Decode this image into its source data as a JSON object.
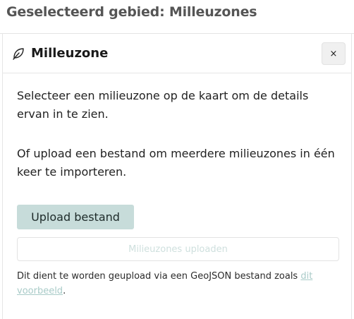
{
  "page": {
    "title": "Geselecteerd gebied: Milleuzones"
  },
  "panel": {
    "icon": "leaf-icon",
    "title": "Milleuzone",
    "close_label": "×",
    "paragraph_1": "Selecteer een milieuzone op de kaart om de details ervan in te zien.",
    "paragraph_2": "Of upload een bestand om meerdere milieuzones in één keer te importeren.",
    "upload_button_label": "Upload bestand",
    "submit_button_label": "Milieuzones uploaden",
    "hint_prefix": "Dit dient te worden geupload via een GeoJSON bestand zoals ",
    "hint_link": "dit voorbeeld",
    "hint_suffix": "."
  },
  "colors": {
    "title_gray": "#555555",
    "upload_button_bg": "#c7dcda",
    "disabled_text": "#cfe0de",
    "link": "#a9cbc8"
  }
}
